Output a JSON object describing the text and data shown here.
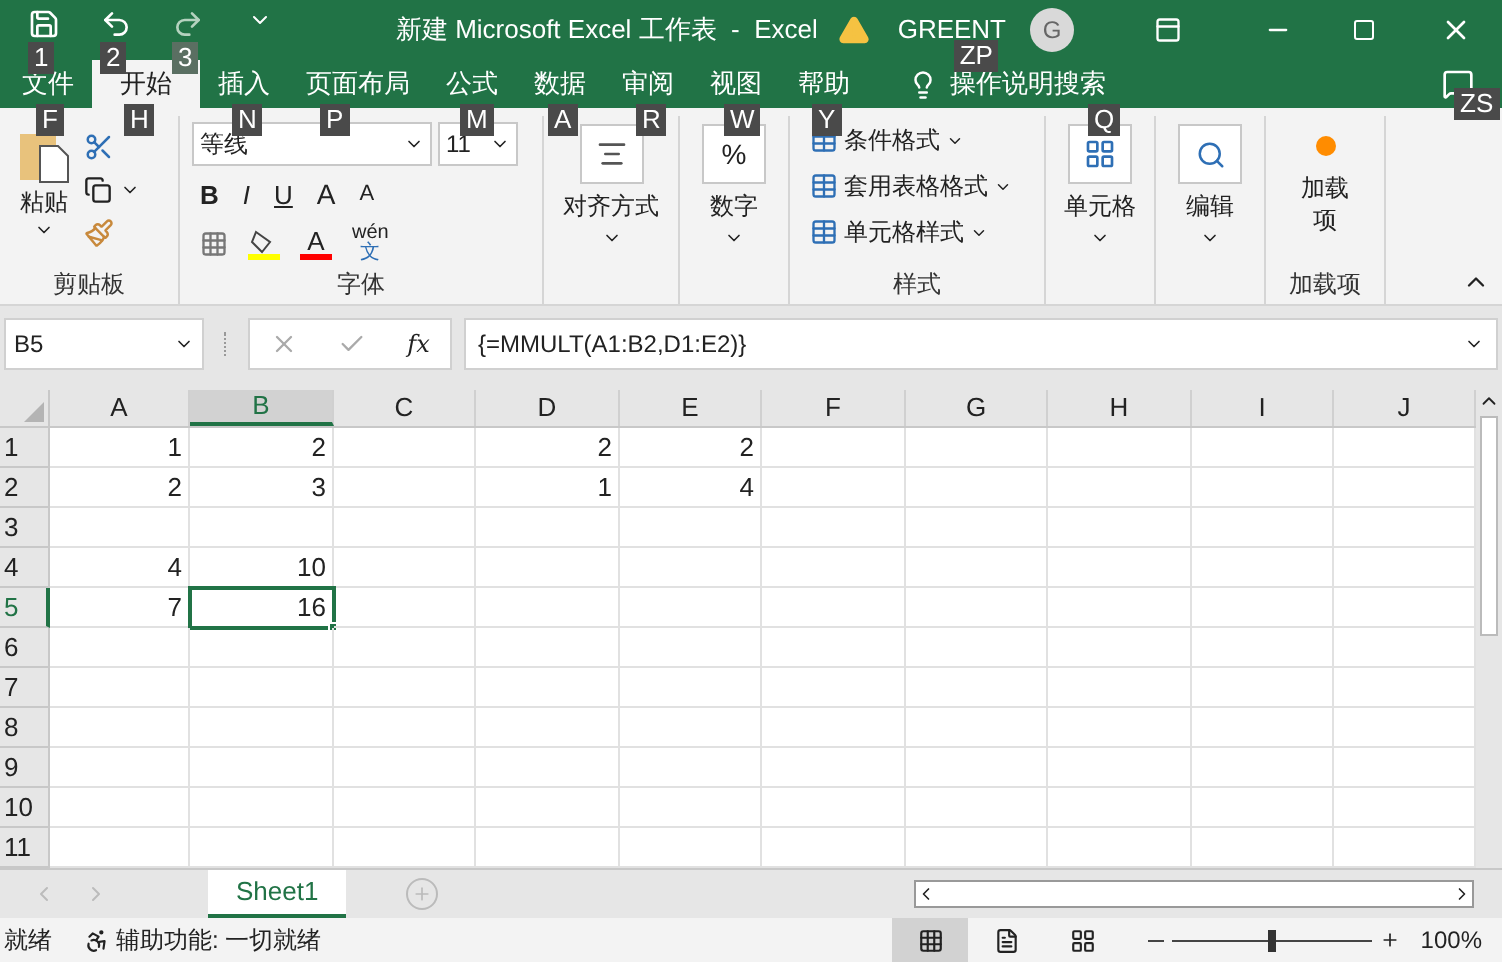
{
  "title_bar": {
    "quick_access": [
      {
        "kind": "save",
        "key_tip": "1",
        "disabled": false
      },
      {
        "kind": "undo",
        "key_tip": "2",
        "disabled": false
      },
      {
        "kind": "redo",
        "key_tip": "3",
        "disabled": true
      },
      {
        "kind": "customize",
        "disabled": false
      }
    ],
    "title": "新建 Microsoft Excel 工作表  -  Excel",
    "user": "GREENT",
    "avatar": "G",
    "account_key_tip": "ZP"
  },
  "tabs": [
    {
      "label": "文件",
      "key_tip": "F",
      "selected": false
    },
    {
      "label": "开始",
      "key_tip": "H",
      "selected": true
    },
    {
      "label": "插入",
      "key_tip": "N",
      "selected": false
    },
    {
      "label": "页面布局",
      "key_tip": "P",
      "selected": false
    },
    {
      "label": "公式",
      "key_tip": "M",
      "selected": false
    },
    {
      "label": "数据",
      "key_tip": "A",
      "selected": false
    },
    {
      "label": "审阅",
      "key_tip": "R",
      "selected": false
    },
    {
      "label": "视图",
      "key_tip": "W",
      "selected": false
    },
    {
      "label": "帮助",
      "key_tip": "Y",
      "selected": false
    }
  ],
  "tell_me": {
    "label": "操作说明搜索",
    "key_tip": "Q"
  },
  "comments_key_tip": "ZS",
  "ribbon": {
    "clipboard": {
      "paste": "粘贴",
      "label": "剪贴板"
    },
    "font": {
      "name": "等线",
      "size": "11",
      "bold": "B",
      "italic": "I",
      "underline": "U",
      "grow": "A",
      "shrink": "A",
      "font_color": "A",
      "phonetic_top": "wén",
      "phonetic_bottom": "文",
      "label": "字体"
    },
    "alignment": {
      "label": "对齐方式"
    },
    "number": {
      "symbol": "%",
      "label": "数字"
    },
    "styles": {
      "items": [
        "条件格式",
        "套用表格格式",
        "单元格样式"
      ],
      "label": "样式"
    },
    "cells": {
      "label": "单元格"
    },
    "editing": {
      "label": "编辑"
    },
    "addins": {
      "button": "加载项",
      "label": "加载项"
    }
  },
  "formula_bar": {
    "name_box": "B5",
    "fx": "fx",
    "formula": "{=MMULT(A1:B2,D1:E2)}"
  },
  "sheet": {
    "columns": [
      {
        "label": "A",
        "selected": false
      },
      {
        "label": "B",
        "selected": true
      },
      {
        "label": "C",
        "selected": false
      },
      {
        "label": "D",
        "selected": false
      },
      {
        "label": "E",
        "selected": false
      },
      {
        "label": "F",
        "selected": false
      },
      {
        "label": "G",
        "selected": false
      },
      {
        "label": "H",
        "selected": false
      },
      {
        "label": "I",
        "selected": false
      },
      {
        "label": "J",
        "selected": false
      }
    ],
    "rows": [
      {
        "label": "1",
        "selected": false,
        "cells": [
          {
            "value": "1",
            "selected": false
          },
          {
            "value": "2",
            "selected": false
          },
          {
            "selected": false
          },
          {
            "value": "2",
            "selected": false
          },
          {
            "value": "2",
            "selected": false
          }
        ]
      },
      {
        "label": "2",
        "selected": false,
        "cells": [
          {
            "value": "2",
            "selected": false
          },
          {
            "value": "3",
            "selected": false
          },
          {
            "selected": false
          },
          {
            "value": "1",
            "selected": false
          },
          {
            "value": "4",
            "selected": false
          }
        ]
      },
      {
        "label": "3",
        "selected": false
      },
      {
        "label": "4",
        "selected": false,
        "cells": [
          {
            "value": "4",
            "selected": false
          },
          {
            "value": "10",
            "selected": false
          }
        ]
      },
      {
        "label": "5",
        "selected": true,
        "cells": [
          {
            "value": "7",
            "selected": false
          },
          {
            "value": "16",
            "selected": true
          }
        ]
      },
      {
        "label": "6",
        "selected": false
      },
      {
        "label": "7",
        "selected": false
      },
      {
        "label": "8",
        "selected": false
      },
      {
        "label": "9",
        "selected": false
      },
      {
        "label": "10",
        "selected": false
      },
      {
        "label": "11",
        "selected": false
      }
    ]
  },
  "sheet_tabs": [
    {
      "label": "Sheet1",
      "selected": true
    }
  ],
  "status_bar": {
    "status": "就绪",
    "accessibility": "辅助功能: 一切就绪",
    "views": [
      {
        "kind": "normal",
        "selected": true
      },
      {
        "kind": "page_layout",
        "selected": false
      },
      {
        "kind": "page_break",
        "selected": false
      }
    ],
    "zoom": {
      "level": 0.5
    },
    "zoom_text": "100%"
  }
}
